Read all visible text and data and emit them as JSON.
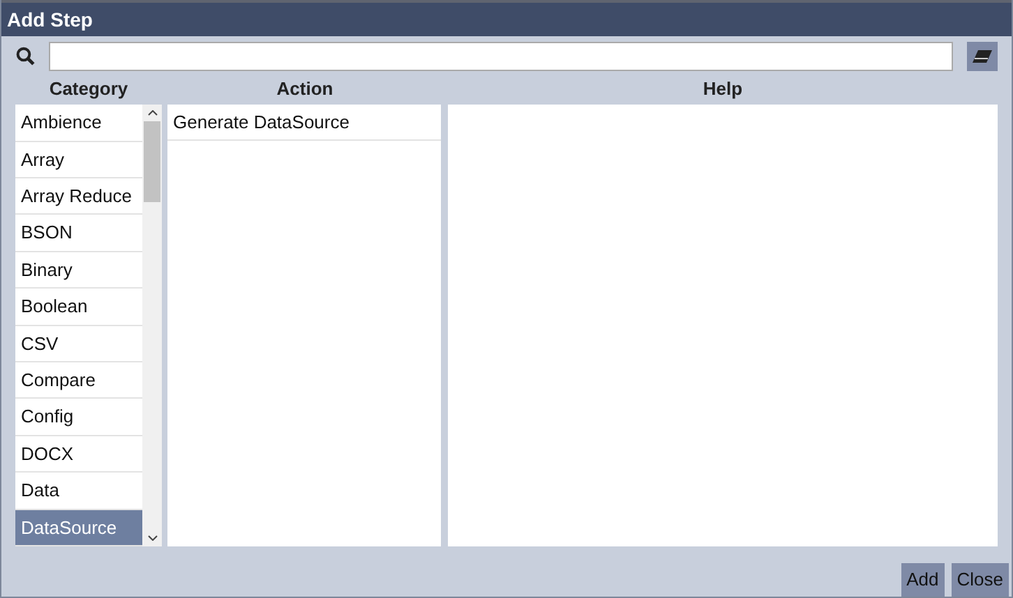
{
  "window": {
    "title": "Add Step"
  },
  "columns": {
    "category": "Category",
    "action": "Action",
    "help": "Help"
  },
  "categories": [
    {
      "label": "Ambience",
      "selected": false
    },
    {
      "label": "Array",
      "selected": false
    },
    {
      "label": "Array Reduce",
      "selected": false
    },
    {
      "label": "BSON",
      "selected": false
    },
    {
      "label": "Binary",
      "selected": false
    },
    {
      "label": "Boolean",
      "selected": false
    },
    {
      "label": "CSV",
      "selected": false
    },
    {
      "label": "Compare",
      "selected": false
    },
    {
      "label": "Config",
      "selected": false
    },
    {
      "label": "DOCX",
      "selected": false
    },
    {
      "label": "Data",
      "selected": false
    },
    {
      "label": "DataSource",
      "selected": true
    }
  ],
  "actions": [
    {
      "label": "Generate DataSource",
      "selected": false
    }
  ],
  "buttons": [
    "Add",
    "Close"
  ]
}
